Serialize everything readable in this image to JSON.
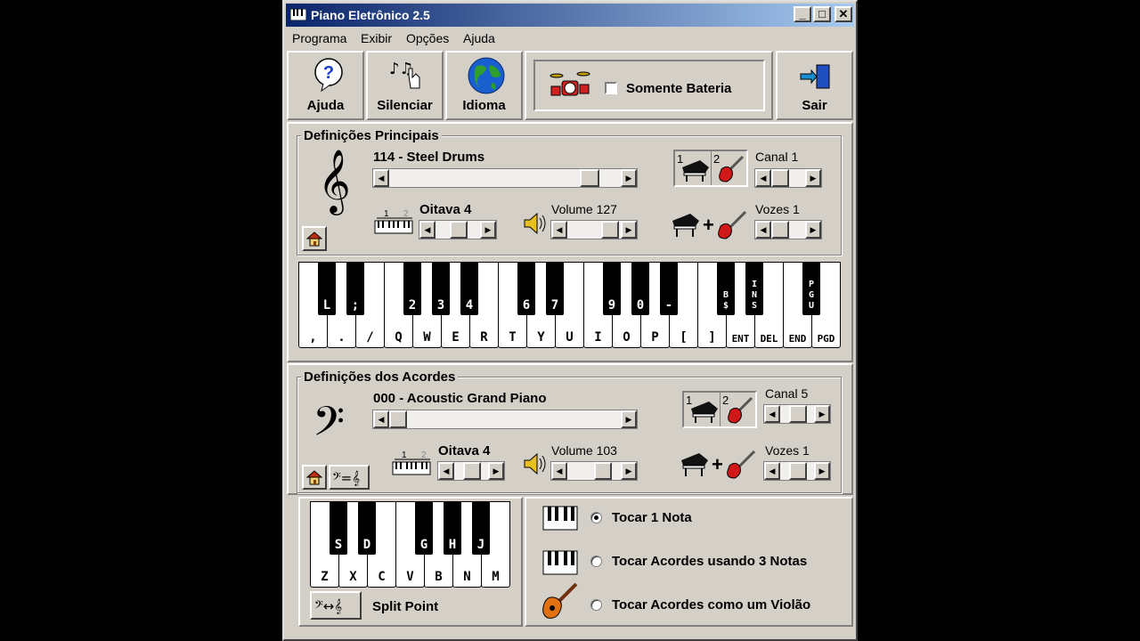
{
  "window": {
    "title": "Piano Eletrônico 2.5",
    "controls": [
      "_",
      "□",
      "✕"
    ]
  },
  "menu": [
    "Programa",
    "Exibir",
    "Opções",
    "Ajuda"
  ],
  "toolbar": {
    "help_label": "Ajuda",
    "silence_label": "Silenciar",
    "language_label": "Idioma",
    "drums_only_label": "Somente Bateria",
    "drums_only_checked": false,
    "exit_label": "Sair"
  },
  "main": {
    "legend": "Definições Principais",
    "instrument": "114 - Steel Drums",
    "instrument_slider": 0.88,
    "channel_label": "Canal 1",
    "octave_label": "Oitava 4",
    "volume_label": "Volume 127",
    "voices_label": "Vozes 1",
    "toggle_nums": [
      "1",
      "2"
    ],
    "octave_nums": [
      "1",
      "2"
    ],
    "white_keys": [
      ",",
      ".",
      "/",
      "Q",
      "W",
      "E",
      "R",
      "T",
      "Y",
      "U",
      "I",
      "O",
      "P",
      "[",
      "]",
      "ENT",
      "DEL",
      "END",
      "PGD"
    ],
    "black_keys": [
      "L",
      ";",
      "2",
      "3",
      "4",
      "6",
      "7",
      "9",
      "0",
      "-",
      "B\n$",
      "I\nN\nS",
      "P\nG\nU"
    ]
  },
  "chords": {
    "legend": "Definições dos Acordes",
    "instrument": "000 - Acoustic Grand Piano",
    "instrument_slider": 0.0,
    "channel_label": "Canal 5",
    "octave_label": "Oitava 4",
    "volume_label": "Volume 103",
    "voices_label": "Vozes 1",
    "white_keys": [
      "Z",
      "X",
      "C",
      "V",
      "B",
      "N",
      "M"
    ],
    "black_keys": [
      "S",
      "D",
      "G",
      "H",
      "J"
    ],
    "split_point_label": "Split Point",
    "options": [
      {
        "label": "Tocar 1 Nota",
        "selected": true
      },
      {
        "label": "Tocar Acordes usando 3 Notas",
        "selected": false
      },
      {
        "label": "Tocar Acordes como um Violão",
        "selected": false
      }
    ]
  },
  "colors": {
    "window_bg": "#d4d0c8",
    "titlebar_start": "#0a246a",
    "titlebar_end": "#a6caf0",
    "guitar_red": "#d01818",
    "globe_blue": "#1a5fd0"
  }
}
